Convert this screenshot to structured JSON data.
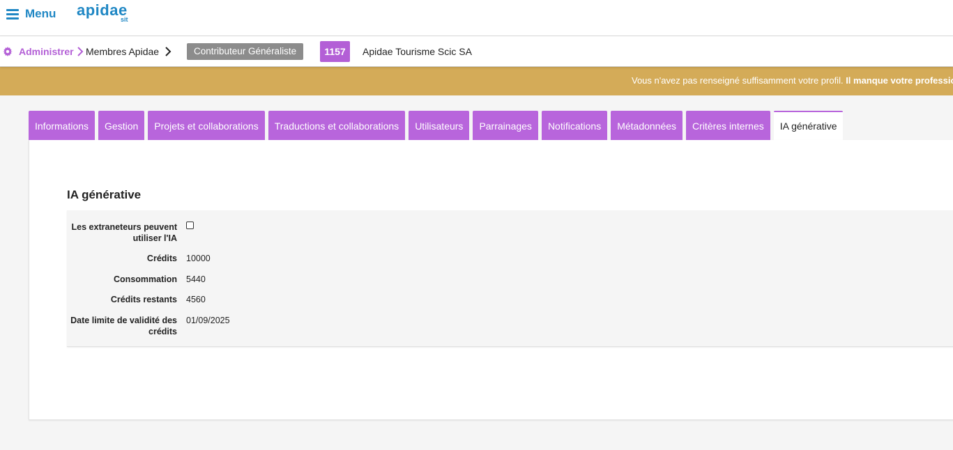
{
  "header": {
    "menu_label": "Menu",
    "logo_text": "apidae",
    "logo_sub": "sit"
  },
  "breadcrumb": {
    "admin": "Administrer",
    "members": "Membres Apidae",
    "role": "Contributeur Généraliste",
    "member_id": "1157",
    "org_name": "Apidae Tourisme Scic SA"
  },
  "warning": {
    "text": "Vous n'avez pas renseigné suffisamment votre profil. ",
    "bold": "Il manque votre profession"
  },
  "tabs": [
    {
      "label": "Informations"
    },
    {
      "label": "Gestion"
    },
    {
      "label": "Projets et collaborations"
    },
    {
      "label": "Traductions et collaborations"
    },
    {
      "label": "Utilisateurs"
    },
    {
      "label": "Parrainages"
    },
    {
      "label": "Notifications"
    },
    {
      "label": "Métadonnées"
    },
    {
      "label": "Critères internes"
    },
    {
      "label": "IA générative"
    }
  ],
  "section": {
    "title": "IA générative",
    "fields": {
      "extranet_label": "Les extraneteurs peuvent utiliser l'IA",
      "extranet_checked": false,
      "credits_label": "Crédits",
      "credits_value": "10000",
      "consumption_label": "Consommation",
      "consumption_value": "5440",
      "remaining_label": "Crédits restants",
      "remaining_value": "4560",
      "deadline_label": "Date limite de validité des crédits",
      "deadline_value": "01/09/2025"
    }
  },
  "colors": {
    "brand_blue": "#1f87c4",
    "accent_purple": "#b865dc",
    "warning_gold": "#d4ab58",
    "badge_gray": "#8c8c8c"
  }
}
